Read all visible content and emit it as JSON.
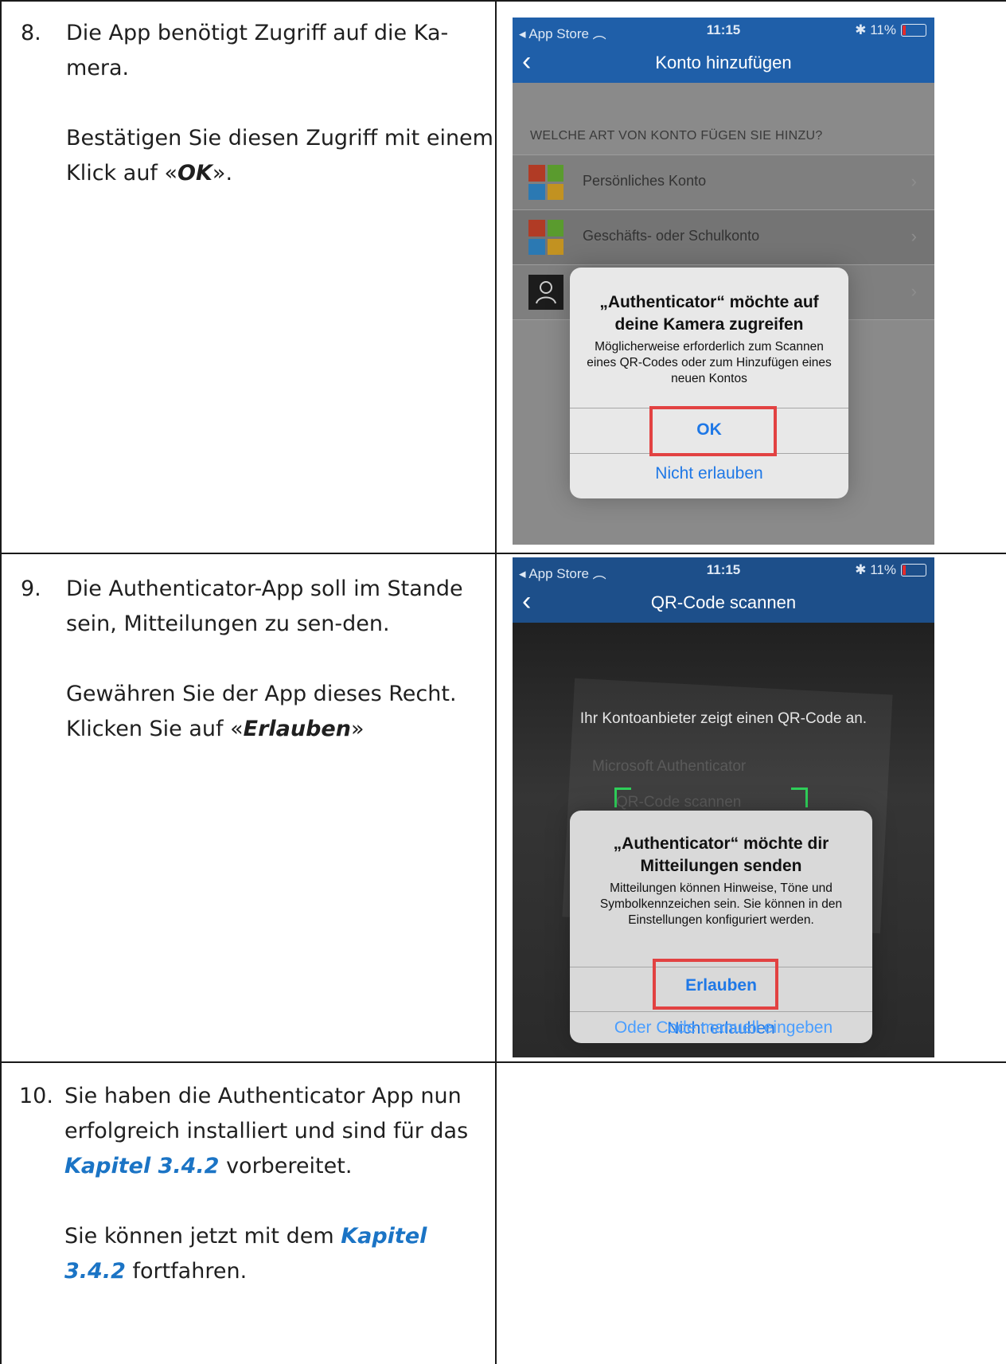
{
  "steps": [
    {
      "number": "8.",
      "line1_pre": "Die App benötigt Zugriff auf die Ka-",
      "line2": "mera.",
      "para2_pre": "Bestätigen Sie diesen Zugriff mit einem Klick auf «",
      "para2_em": "OK",
      "para2_post": "»."
    },
    {
      "number": "9.",
      "para1": "Die Authenticator-App soll im Stande sein, Mitteilungen zu sen-den.",
      "para2_pre": "Gewähren Sie der App dieses Recht. Klicken Sie auf «",
      "para2_em": "Erlauben",
      "para2_post": "»"
    },
    {
      "number": "10.",
      "para1_pre": "Sie haben die Authenticator App nun erfolgreich installiert und sind für das ",
      "para1_link": "Kapitel 3.4.2",
      "para1_post": " vorbereitet.",
      "para2_pre": "Sie können jetzt mit dem ",
      "para2_link": "Kapitel 3.4.2",
      "para2_post": " fortfahren."
    }
  ],
  "screen1": {
    "status": {
      "back_app": "App Store",
      "time": "11:15",
      "battery": "11%"
    },
    "nav_title": "Konto hinzufügen",
    "section_header": "WELCHE ART VON KONTO FÜGEN SIE HINZU?",
    "rows": [
      "Persönliches Konto",
      "Geschäfts- oder Schulkonto"
    ],
    "alert": {
      "title": "„Authenticator“ möchte auf deine Kamera zugreifen",
      "message": "Möglicherweise erforderlich zum Scannen eines QR-Codes oder zum Hinzufügen eines neuen Kontos",
      "primary": "OK",
      "secondary": "Nicht erlauben"
    }
  },
  "screen2": {
    "status": {
      "back_app": "App Store",
      "time": "11:15",
      "battery": "11%"
    },
    "nav_title": "QR-Code scannen",
    "hint": "Ihr Kontoanbieter zeigt einen QR-Code an.",
    "camera_background_text": [
      "Microsoft Authenticator",
      "QR-Code scannen"
    ],
    "alert": {
      "title": "„Authenticator“ möchte dir Mitteilungen senden",
      "message": "Mitteilungen können Hinweise, Töne und Symbolkennzeichen sein. Sie können in den Einstellungen konfiguriert werden.",
      "primary": "Erlauben",
      "secondary": "Nicht erlauben"
    },
    "footer_link": "Oder Code manuell eingeben"
  },
  "colors": {
    "nav_blue": "#1f5fa9",
    "dim_blue": "#1d4f8a",
    "ios_blue": "#1f78e6",
    "highlight_red": "#e24242",
    "link_blue": "#1b74c5"
  }
}
